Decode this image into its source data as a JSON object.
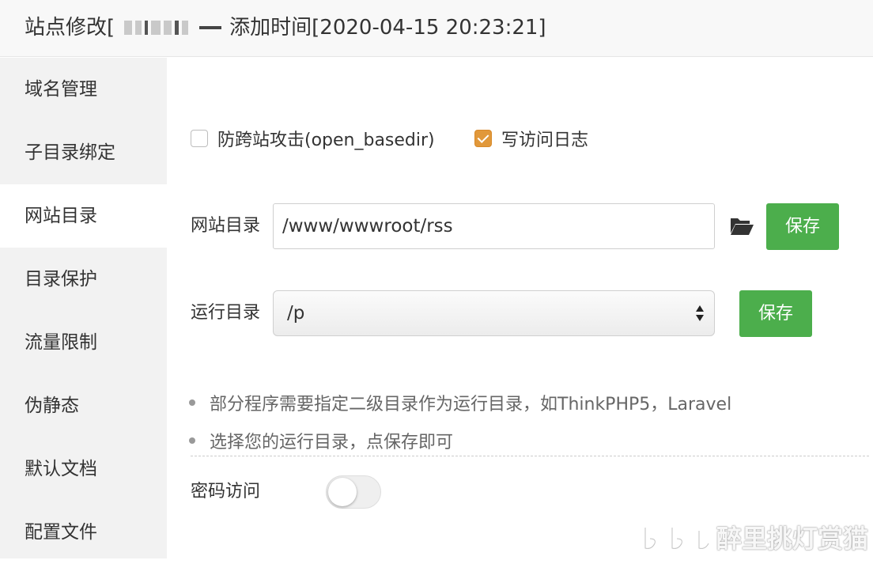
{
  "header": {
    "title_prefix": "站点修改[",
    "title_suffix": "添加时间[2020-04-15 20:23:21]"
  },
  "sidebar": {
    "items": [
      {
        "label": "域名管理"
      },
      {
        "label": "子目录绑定"
      },
      {
        "label": "网站目录",
        "active": true
      },
      {
        "label": "目录保护"
      },
      {
        "label": "流量限制"
      },
      {
        "label": "伪静态"
      },
      {
        "label": "默认文档"
      },
      {
        "label": "配置文件"
      }
    ]
  },
  "options": {
    "open_basedir": {
      "label": "防跨站攻击(open_basedir)",
      "checked": false
    },
    "access_log": {
      "label": "写访问日志",
      "checked": true
    }
  },
  "site_dir": {
    "label": "网站目录",
    "value": "/www/wwwroot/rss",
    "save_label": "保存"
  },
  "run_dir": {
    "label": "运行目录",
    "selected": "/p",
    "save_label": "保存"
  },
  "tips": [
    "部分程序需要指定二级目录作为运行目录，如ThinkPHP5，Laravel",
    "选择您的运行目录，点保存即可"
  ],
  "password_access": {
    "label": "密码访问",
    "enabled": false
  },
  "watermark": {
    "text": "醉里挑灯赏猫"
  },
  "colors": {
    "accent_green": "#4cae4c",
    "checkbox_orange": "#e1983a",
    "sidebar_bg": "#f2f2f2"
  }
}
